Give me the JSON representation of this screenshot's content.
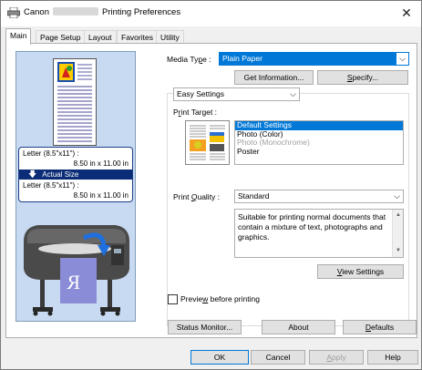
{
  "window": {
    "title_prefix": "Canon",
    "title_suffix": "Printing Preferences",
    "close_symbol": "✕"
  },
  "tabs": [
    {
      "label": "Main"
    },
    {
      "label": "Page Setup"
    },
    {
      "label": "Layout"
    },
    {
      "label": "Favorites"
    },
    {
      "label": "Utility"
    }
  ],
  "preview": {
    "input_size": "Letter (8.5\"x11\") :",
    "input_dims": "8.50 in x 11.00 in",
    "actual_size_label": "Actual Size",
    "output_size": "Letter (8.5\"x11\") :",
    "output_dims": "8.50 in x 11.00 in"
  },
  "media_type": {
    "label_pre": "Media Ty",
    "label_u": "p",
    "label_post": "e :",
    "value": "Plain Paper"
  },
  "buttons": {
    "get_information": "Get Information...",
    "specify_u": "S",
    "specify_rest": "pecify...",
    "view_settings_u": "V",
    "view_settings_rest": "iew Settings",
    "status_monitor": "Status Monitor...",
    "about": "About",
    "defaults_u": "D",
    "defaults_rest": "efaults",
    "ok": "OK",
    "cancel": "Cancel",
    "apply_u": "A",
    "apply_rest": "pply",
    "help": "Help"
  },
  "settings_mode": "Easy Settings",
  "print_target": {
    "label_pre": "P",
    "label_u": "r",
    "label_post": "int Target :",
    "items": [
      {
        "label": "Default Settings",
        "state": "selected"
      },
      {
        "label": "Photo (Color)",
        "state": "normal"
      },
      {
        "label": "Photo (Monochrome)",
        "state": "disabled"
      },
      {
        "label": "Poster",
        "state": "normal"
      }
    ]
  },
  "print_quality": {
    "label_pre": "Print ",
    "label_u": "Q",
    "label_post": "uality :",
    "value": "Standard"
  },
  "description": "Suitable for printing normal documents that contain a mixture of text, photographs and graphics.",
  "preview_checkbox": {
    "label_pre": "Previe",
    "label_u": "w",
    "label_post": " before printing",
    "checked": false
  }
}
